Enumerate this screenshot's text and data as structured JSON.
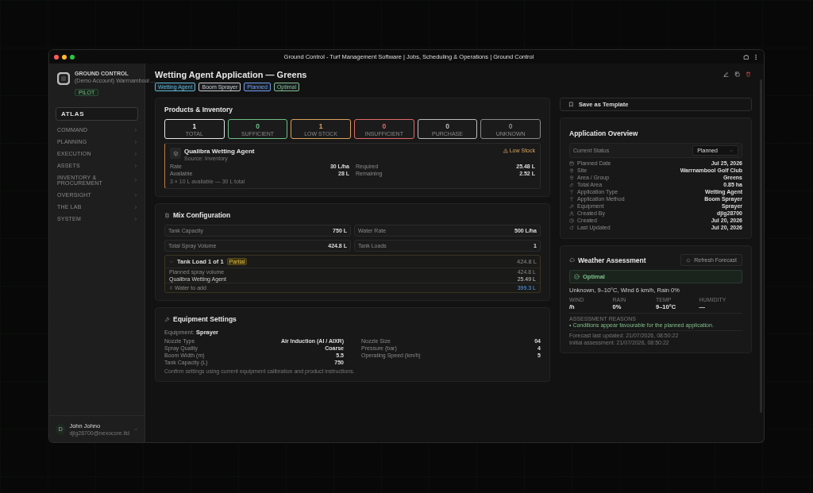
{
  "window": {
    "title": "Ground Control - Turf Management Software | Jobs, Scheduling & Operations | Ground Control"
  },
  "sidebar": {
    "brand": "GROUND CONTROL",
    "account": "(Demo Account) Warrnambool ...",
    "plan": "PILOT",
    "section": "ATLAS",
    "items": [
      {
        "label": "COMMAND"
      },
      {
        "label": "PLANNING"
      },
      {
        "label": "EXECUTION"
      },
      {
        "label": "ASSETS"
      },
      {
        "label": "INVENTORY & PROCUREMENT"
      },
      {
        "label": "OVERSIGHT"
      },
      {
        "label": "THE LAB"
      },
      {
        "label": "SYSTEM"
      }
    ],
    "user": {
      "initial": "D",
      "name": "John Johno",
      "email": "djlg28700@nexocore.ltd"
    }
  },
  "header": {
    "title": "Wetting Agent Application — Greens",
    "tags": [
      {
        "label": "Wetting Agent",
        "color": "#5bb8d6"
      },
      {
        "label": "Boom Sprayer",
        "color": "#c8c8c8"
      },
      {
        "label": "Planned",
        "color": "#6e9ef0"
      },
      {
        "label": "Optimal",
        "color": "#7fbf8a"
      }
    ]
  },
  "products": {
    "title": "Products & Inventory",
    "stats": [
      {
        "value": "1",
        "label": "TOTAL",
        "color": "#e6e6e6"
      },
      {
        "value": "0",
        "label": "SUFFICIENT",
        "color": "#6fbf8a"
      },
      {
        "value": "1",
        "label": "LOW STOCK",
        "color": "#d9a25a"
      },
      {
        "value": "0",
        "label": "INSUFFICIENT",
        "color": "#e06a6a"
      },
      {
        "value": "0",
        "label": "PURCHASE",
        "color": "#bdbdbd"
      },
      {
        "value": "0",
        "label": "UNKNOWN",
        "color": "#8a8a8a"
      }
    ],
    "product": {
      "name": "Qualibra Wetting Agent",
      "source": "Source: Inventory",
      "status": "Low Stock",
      "rows": [
        {
          "label": "Rate",
          "value": "30 L/ha"
        },
        {
          "label": "Required",
          "value": "25.48 L"
        },
        {
          "label": "Available",
          "value": "28 L"
        },
        {
          "label": "Remaining",
          "value": "2.52 L"
        }
      ],
      "note": "3 × 10 L available — 30 L total"
    }
  },
  "mix": {
    "title": "Mix Configuration",
    "fields": [
      {
        "label": "Tank Capacity",
        "value": "750 L"
      },
      {
        "label": "Water Rate",
        "value": "500 L/ha"
      },
      {
        "label": "Total Spray Volume",
        "value": "424.8 L"
      },
      {
        "label": "Tank Loads",
        "value": "1"
      }
    ],
    "tank_load": {
      "title": "Tank Load 1 of 1",
      "badge": "Partial",
      "total": "424.8 L",
      "expanded": true,
      "rows": [
        {
          "kind": "plain",
          "label": "Planned spray volume",
          "value": "424.8 L"
        },
        {
          "kind": "product",
          "label": "Qualibra Wetting Agent",
          "value": "25.49 L"
        },
        {
          "kind": "water",
          "label": "Water to add",
          "value": "399.3 L"
        }
      ]
    }
  },
  "equipment": {
    "title": "Equipment Settings",
    "equipment_label": "Equipment:",
    "equipment_value": "Sprayer",
    "rows": [
      {
        "label": "Nozzle Type",
        "value": "Air Induction (AI / AIXR)"
      },
      {
        "label": "Nozzle Size",
        "value": "04"
      },
      {
        "label": "Spray Quality",
        "value": "Coarse"
      },
      {
        "label": "Pressure (bar)",
        "value": "4"
      },
      {
        "label": "Boom Width (m)",
        "value": "5.5"
      },
      {
        "label": "Operating Speed (km/h)",
        "value": "5"
      },
      {
        "label": "Tank Capacity (L)",
        "value": "750"
      }
    ],
    "note": "Confirm settings using current equipment calibration and product instructions."
  },
  "save_template": "Save as Template",
  "overview": {
    "title": "Application Overview",
    "status_label": "Current Status",
    "status_value": "Planned",
    "rows": [
      {
        "label": "Planned Date",
        "value": "Jul 25, 2026"
      },
      {
        "label": "Site",
        "value": "Warrnambool Golf Club"
      },
      {
        "label": "Area / Group",
        "value": "Greens"
      },
      {
        "label": "Total Area",
        "value": "0.85 ha"
      },
      {
        "label": "Application Type",
        "value": "Wetting Agent"
      },
      {
        "label": "Application Method",
        "value": "Boom Sprayer"
      },
      {
        "label": "Equipment",
        "value": "Sprayer"
      },
      {
        "label": "Created By",
        "value": "djlg28700"
      },
      {
        "label": "Created",
        "value": "Jul 20, 2026"
      },
      {
        "label": "Last Updated",
        "value": "Jul 20, 2026"
      }
    ]
  },
  "weather": {
    "title": "Weather Assessment",
    "refresh": "Refresh Forecast",
    "status": "Optimal",
    "summary": "Unknown, 9–10°C, Wind 6 km/h, Rain 0%",
    "stats": [
      {
        "label": "WIND",
        "value": "/h"
      },
      {
        "label": "RAIN",
        "value": "0%"
      },
      {
        "label": "TEMP",
        "value": "9–10°C"
      },
      {
        "label": "HUMIDITY",
        "value": "—"
      }
    ],
    "reasons_label": "ASSESSMENT REASONS",
    "reasons": [
      "• Conditions appear favourable for the planned application."
    ],
    "footer": [
      "Forecast last updated: 21/07/2026, 08:50:22",
      "Initial assessment: 21/07/2026, 08:50:22"
    ]
  }
}
